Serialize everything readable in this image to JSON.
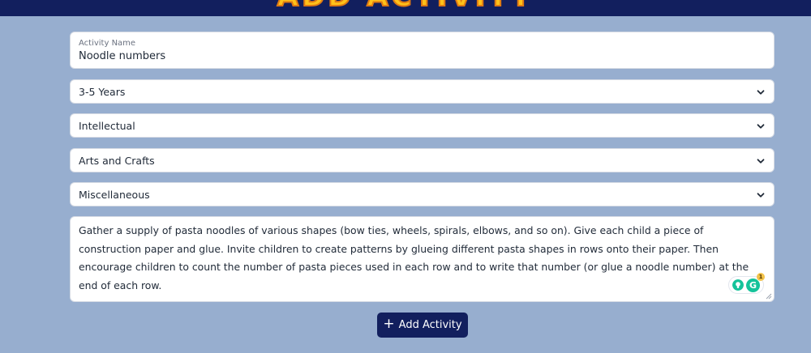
{
  "header": {
    "title": "ADD ACTIVITY"
  },
  "form": {
    "activity_name": {
      "label": "Activity Name",
      "value": "Noodle numbers"
    },
    "age_group": {
      "selected": "3-5 Years"
    },
    "domain": {
      "selected": "Intellectual"
    },
    "activity_type": {
      "selected": "Arts and Crafts"
    },
    "category": {
      "selected": "Miscellaneous"
    },
    "description": {
      "value": "Gather a supply of pasta noodles of various shapes (bow ties, wheels, spirals, elbows, and so on). Give each child a piece of construction paper and glue. Invite children to create patterns by glueing different pasta shapes in rows onto their paper. Then encourage children to count the number of pasta pieces used in each row and to write that number (or glue a noodle number) at the end of each row."
    },
    "assistant_widget": {
      "badge_count": "1",
      "g_letter": "G"
    }
  },
  "actions": {
    "submit": {
      "plus": "+",
      "label": "Add Activity"
    }
  },
  "colors": {
    "background": "#97aecf",
    "header": "#121f5e",
    "title_fill": "#ffc21a",
    "button": "#121f5e",
    "assistant_green": "#15c39a"
  },
  "icons": [
    "chevron-down-icon",
    "plus-icon",
    "lightbulb-icon",
    "grammarly-icon"
  ]
}
